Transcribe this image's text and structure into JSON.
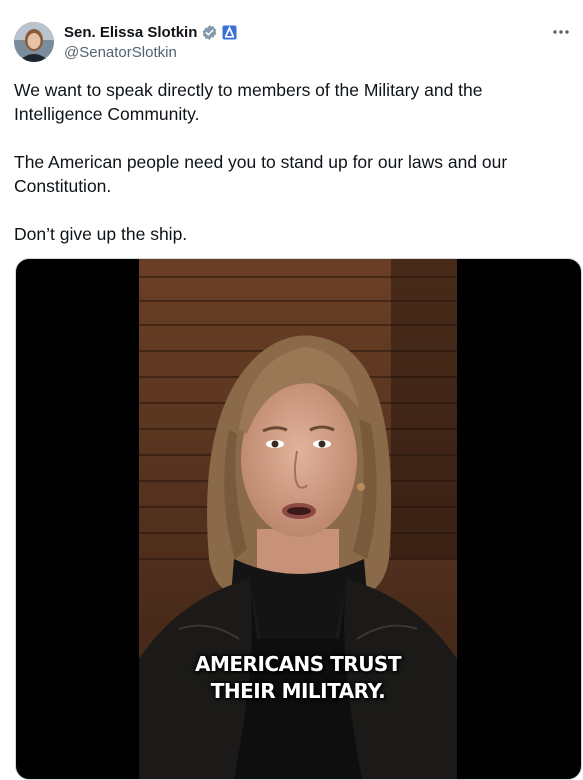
{
  "author": {
    "display_name": "Sen. Elissa Slotkin",
    "handle": "@SenatorSlotkin",
    "verified_icon": "verified-badge-icon",
    "affiliation_icon": "government-label-icon"
  },
  "more_icon": "more-options-icon",
  "tweet": {
    "paragraphs": [
      "We want to speak directly to members of the Military and the Intelligence Community.",
      "The American people need you to stand up for our laws and our Constitution.",
      "Don’t give up the ship."
    ]
  },
  "video": {
    "caption_line_1": "AMERICANS TRUST",
    "caption_line_2": "THEIR MILITARY."
  },
  "colors": {
    "text_primary": "#0f1419",
    "text_secondary": "#536471",
    "verified_gray": "#829aab",
    "gov_blue": "#3a6ed8"
  }
}
